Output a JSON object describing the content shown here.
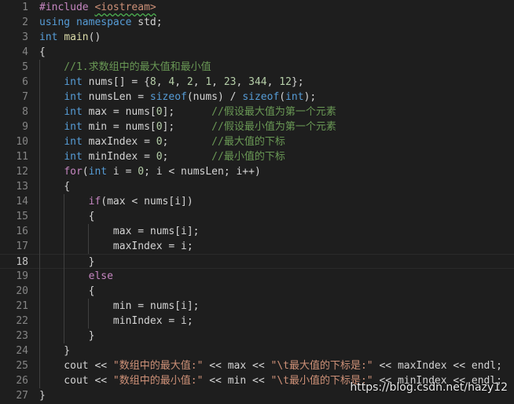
{
  "editor": {
    "lines": [
      {
        "n": "1",
        "t": [
          [
            "pp",
            "#include "
          ],
          [
            "inc",
            "<iostream>"
          ]
        ]
      },
      {
        "n": "2",
        "t": [
          [
            "kw",
            "using"
          ],
          [
            "id",
            " "
          ],
          [
            "kw",
            "namespace"
          ],
          [
            "id",
            " std;"
          ]
        ]
      },
      {
        "n": "3",
        "t": [
          [
            "kw",
            "int"
          ],
          [
            "id",
            " "
          ],
          [
            "fn",
            "main"
          ],
          [
            "id",
            "()"
          ]
        ]
      },
      {
        "n": "4",
        "t": [
          [
            "id",
            "{"
          ]
        ]
      },
      {
        "n": "5",
        "t": [
          [
            "cm",
            "    //1.求数组中的最大值和最小值"
          ]
        ]
      },
      {
        "n": "6",
        "t": [
          [
            "id",
            "    "
          ],
          [
            "kw",
            "int"
          ],
          [
            "id",
            " nums[] = {"
          ],
          [
            "num",
            "8"
          ],
          [
            "id",
            ", "
          ],
          [
            "num",
            "4"
          ],
          [
            "id",
            ", "
          ],
          [
            "num",
            "2"
          ],
          [
            "id",
            ", "
          ],
          [
            "num",
            "1"
          ],
          [
            "id",
            ", "
          ],
          [
            "num",
            "23"
          ],
          [
            "id",
            ", "
          ],
          [
            "num",
            "344"
          ],
          [
            "id",
            ", "
          ],
          [
            "num",
            "12"
          ],
          [
            "id",
            "};"
          ]
        ]
      },
      {
        "n": "7",
        "t": [
          [
            "id",
            "    "
          ],
          [
            "kw",
            "int"
          ],
          [
            "id",
            " numsLen = "
          ],
          [
            "kw",
            "sizeof"
          ],
          [
            "id",
            "(nums) / "
          ],
          [
            "kw",
            "sizeof"
          ],
          [
            "id",
            "("
          ],
          [
            "kw",
            "int"
          ],
          [
            "id",
            ");"
          ]
        ]
      },
      {
        "n": "8",
        "t": [
          [
            "id",
            "    "
          ],
          [
            "kw",
            "int"
          ],
          [
            "id",
            " max = nums["
          ],
          [
            "num",
            "0"
          ],
          [
            "id",
            "];      "
          ],
          [
            "cm",
            "//假设最大值为第一个元素"
          ]
        ]
      },
      {
        "n": "9",
        "t": [
          [
            "id",
            "    "
          ],
          [
            "kw",
            "int"
          ],
          [
            "id",
            " min = nums["
          ],
          [
            "num",
            "0"
          ],
          [
            "id",
            "];      "
          ],
          [
            "cm",
            "//假设最小值为第一个元素"
          ]
        ]
      },
      {
        "n": "10",
        "t": [
          [
            "id",
            "    "
          ],
          [
            "kw",
            "int"
          ],
          [
            "id",
            " maxIndex = "
          ],
          [
            "num",
            "0"
          ],
          [
            "id",
            ";       "
          ],
          [
            "cm",
            "//最大值的下标"
          ]
        ]
      },
      {
        "n": "11",
        "t": [
          [
            "id",
            "    "
          ],
          [
            "kw",
            "int"
          ],
          [
            "id",
            " minIndex = "
          ],
          [
            "num",
            "0"
          ],
          [
            "id",
            ";       "
          ],
          [
            "cm",
            "//最小值的下标"
          ]
        ]
      },
      {
        "n": "12",
        "t": [
          [
            "id",
            "    "
          ],
          [
            "ctl",
            "for"
          ],
          [
            "id",
            "("
          ],
          [
            "kw",
            "int"
          ],
          [
            "id",
            " i = "
          ],
          [
            "num",
            "0"
          ],
          [
            "id",
            "; i < numsLen; i++)"
          ]
        ]
      },
      {
        "n": "13",
        "t": [
          [
            "id",
            "    {"
          ]
        ]
      },
      {
        "n": "14",
        "t": [
          [
            "id",
            "        "
          ],
          [
            "ctl",
            "if"
          ],
          [
            "id",
            "(max < nums[i])"
          ]
        ]
      },
      {
        "n": "15",
        "t": [
          [
            "id",
            "        {"
          ]
        ]
      },
      {
        "n": "16",
        "t": [
          [
            "id",
            "            max = nums[i];"
          ]
        ]
      },
      {
        "n": "17",
        "t": [
          [
            "id",
            "            maxIndex = i;"
          ]
        ]
      },
      {
        "n": "18",
        "t": [
          [
            "id",
            "        }"
          ]
        ]
      },
      {
        "n": "19",
        "t": [
          [
            "id",
            "        "
          ],
          [
            "ctl",
            "else"
          ]
        ]
      },
      {
        "n": "20",
        "t": [
          [
            "id",
            "        {"
          ]
        ]
      },
      {
        "n": "21",
        "t": [
          [
            "id",
            "            min = nums[i];"
          ]
        ]
      },
      {
        "n": "22",
        "t": [
          [
            "id",
            "            minIndex = i;"
          ]
        ]
      },
      {
        "n": "23",
        "t": [
          [
            "id",
            "        }"
          ]
        ]
      },
      {
        "n": "24",
        "t": [
          [
            "id",
            "    }"
          ]
        ]
      },
      {
        "n": "25",
        "t": [
          [
            "id",
            "    cout << "
          ],
          [
            "str",
            "\"数组中的最大值:\""
          ],
          [
            "id",
            " << max << "
          ],
          [
            "str",
            "\"\\t最大值的下标是:\""
          ],
          [
            "id",
            " << maxIndex << endl;"
          ]
        ]
      },
      {
        "n": "26",
        "t": [
          [
            "id",
            "    cout << "
          ],
          [
            "str",
            "\"数组中的最小值:\""
          ],
          [
            "id",
            " << min << "
          ],
          [
            "str",
            "\"\\t最小值的下标是:\""
          ],
          [
            "id",
            " << minIndex << endl;"
          ]
        ]
      },
      {
        "n": "27",
        "t": [
          [
            "id",
            "}"
          ]
        ]
      }
    ],
    "active_line": "18"
  },
  "watermark": "https://blog.csdn.net/hazy12",
  "colors": {
    "background": "#1e1e1e",
    "keyword": "#569cd6",
    "control": "#c586c0",
    "comment": "#6a9955",
    "string": "#ce9178",
    "number": "#b5cea8"
  }
}
